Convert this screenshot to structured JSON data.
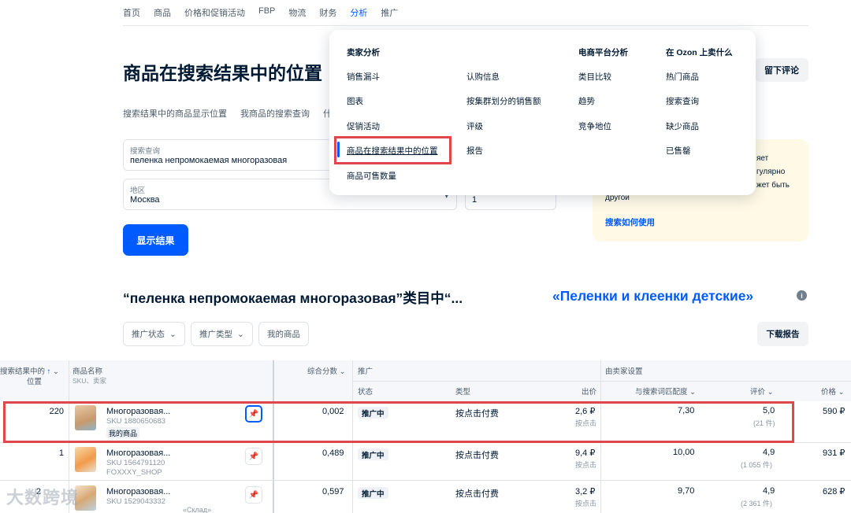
{
  "topnav": [
    "首页",
    "商品",
    "价格和促销活动",
    "FBP",
    "物流",
    "财务",
    "分析",
    "推广"
  ],
  "page_title": "商品在搜索结果中的位置",
  "review_button": "留下评论",
  "subtabs": [
    "搜索结果中的商品显示位置",
    "我商品的搜索查询",
    "什"
  ],
  "search_field": {
    "label": "搜索查询",
    "value": "пеленка непромокаемая многоразовая"
  },
  "region_field": {
    "label": "地区",
    "value": "Москва"
  },
  "count_field": {
    "value": "1"
  },
  "show_button": "显示结果",
  "info_card": {
    "frag1": "яет",
    "frag2": "гулярно",
    "frag3": "жет быть",
    "text": "другой",
    "link": "搜索如何使用"
  },
  "dropdown": {
    "col1_head": "卖家分析",
    "col1": [
      "销售漏斗",
      "图表",
      "促销活动",
      "商品在搜索结果中的位置",
      "商品可售数量"
    ],
    "col2": [
      "认购信息",
      "按集群划分的销售额",
      "评级",
      "报告"
    ],
    "col3_head": "电商平台分析",
    "col3": [
      "类目比较",
      "趋势",
      "竞争地位"
    ],
    "col4_head": "在 Ozon 上卖什么",
    "col4": [
      "热门商品",
      "搜索查询",
      "缺少商品",
      "已售罄"
    ]
  },
  "section": {
    "title": "“пеленка непромокаемая многоразовая”类目中“...",
    "category": "«Пеленки и клеенки детские»",
    "info_icon": "i"
  },
  "filters": [
    "推广状态",
    "推广类型",
    "我的商品"
  ],
  "download_button": "下载报告",
  "table": {
    "h_position": "搜索结果中的",
    "h_position2": "位置",
    "h_name": "商品名称",
    "h_name_sub": "SKU、卖家",
    "h_score": "综合分数",
    "h_promo": "推广",
    "h_status": "状态",
    "h_type": "类型",
    "h_bid": "出价",
    "h_seller": "由卖家设置",
    "h_match": "与搜索词匹配度",
    "h_rating": "评价",
    "h_price": "价格",
    "rows": [
      {
        "pos": "220",
        "name": "Многоразовая...",
        "sku": "SKU 1880650683",
        "seller": "我的商品",
        "score": "0,002",
        "status": "推广中",
        "type": "按点击付费",
        "bid": "2,6 ₽",
        "bid_sub": "按点击",
        "match": "7,30",
        "rating": "5,0",
        "rating_sub": "(21 件)",
        "price": "590 ₽"
      },
      {
        "pos": "1",
        "name": "Многоразовая...",
        "sku": "SKU 1564791120",
        "seller": "FOXXXY_SHOP",
        "score": "0,489",
        "status": "推广中",
        "type": "按点击付费",
        "bid": "9,4 ₽",
        "bid_sub": "按点击",
        "match": "10,00",
        "rating": "4,9",
        "rating_sub": "(1 055 件)",
        "price": "931 ₽"
      },
      {
        "pos": "2",
        "name": "Многоразовая...",
        "sku": "SKU 1529043332",
        "seller": "«Склад»",
        "score": "0,597",
        "status": "推广中",
        "type": "按点击付费",
        "bid": "3,2 ₽",
        "bid_sub": "按点击",
        "match": "9,70",
        "rating": "4,9",
        "rating_sub": "(2 361 件)",
        "price": "628 ₽"
      }
    ]
  },
  "watermark": "大数跨境"
}
